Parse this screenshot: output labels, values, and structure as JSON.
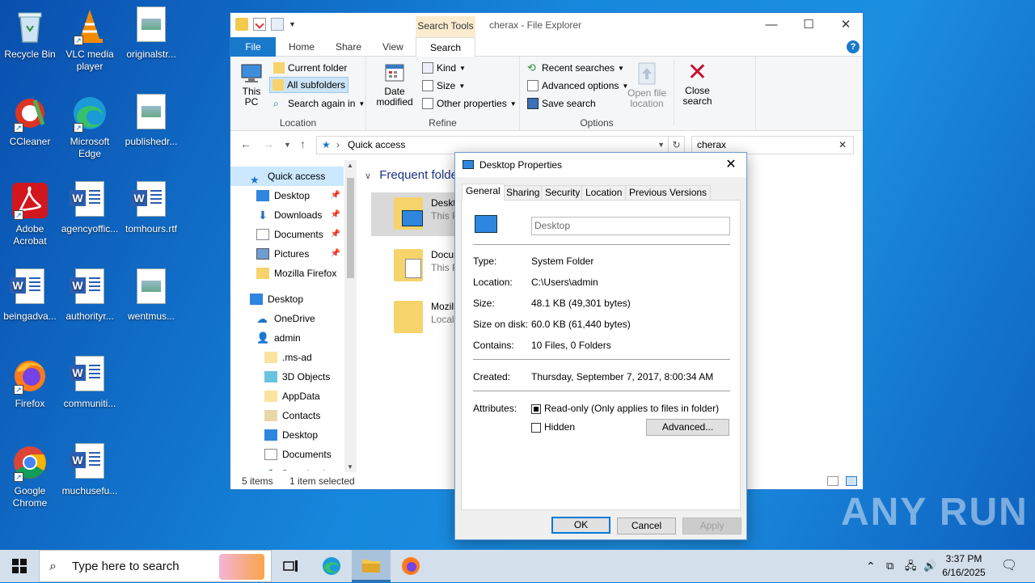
{
  "desktop": {
    "icons": [
      {
        "label": "Recycle Bin"
      },
      {
        "label": "VLC media player"
      },
      {
        "label": "originalstr..."
      },
      {
        "label": "CCleaner"
      },
      {
        "label": "Microsoft Edge"
      },
      {
        "label": "publishedr..."
      },
      {
        "label": "Adobe Acrobat"
      },
      {
        "label": "agencyoffic..."
      },
      {
        "label": "tomhours.rtf"
      },
      {
        "label": "beingadva..."
      },
      {
        "label": "authorityr..."
      },
      {
        "label": "wentmus..."
      },
      {
        "label": "Firefox"
      },
      {
        "label": "communiti..."
      },
      {
        "label": "Google Chrome"
      },
      {
        "label": "muchusefu..."
      }
    ],
    "watermark": "ANY RUN"
  },
  "explorer": {
    "title": "cherax - File Explorer",
    "context_tab": "Search Tools",
    "tabs": [
      "File",
      "Home",
      "Share",
      "View",
      "Search"
    ],
    "ribbon": {
      "location": {
        "label": "Location",
        "this_pc": "This PC",
        "current_folder": "Current folder",
        "all_subfolders": "All subfolders",
        "search_again": "Search again in"
      },
      "refine": {
        "label": "Refine",
        "date_modified": "Date modified",
        "kind": "Kind",
        "size": "Size",
        "other_properties": "Other properties"
      },
      "options": {
        "label": "Options",
        "recent_searches": "Recent searches",
        "advanced_options": "Advanced options",
        "save_search": "Save search",
        "open_file_location": "Open file location",
        "close_search": "Close search"
      }
    },
    "address": "Quick access",
    "search_value": "cherax",
    "nav": [
      {
        "label": "Quick access"
      },
      {
        "label": "Desktop"
      },
      {
        "label": "Downloads"
      },
      {
        "label": "Documents"
      },
      {
        "label": "Pictures"
      },
      {
        "label": "Mozilla Firefox"
      },
      {
        "label": "Desktop"
      },
      {
        "label": "OneDrive"
      },
      {
        "label": "admin"
      },
      {
        "label": ".ms-ad"
      },
      {
        "label": "3D Objects"
      },
      {
        "label": "AppData"
      },
      {
        "label": "Contacts"
      },
      {
        "label": "Desktop"
      },
      {
        "label": "Documents"
      },
      {
        "label": "Downloads"
      }
    ],
    "section_title": "Frequent folde",
    "tiles": [
      {
        "name": "Deskto",
        "sub": "This P"
      },
      {
        "name": "Docur",
        "sub": "This P"
      },
      {
        "name": "Mozill",
        "sub": "Local"
      }
    ],
    "status": {
      "items": "5 items",
      "selected": "1 item selected"
    }
  },
  "dialog": {
    "title": "Desktop Properties",
    "tabs": [
      "General",
      "Sharing",
      "Security",
      "Location",
      "Previous Versions"
    ],
    "name_value": "Desktop",
    "type_label": "Type:",
    "type_value": "System Folder",
    "location_label": "Location:",
    "location_value": "C:\\Users\\admin",
    "size_label": "Size:",
    "size_value": "48.1 KB (49,301 bytes)",
    "disk_label": "Size on disk:",
    "disk_value": "60.0 KB (61,440 bytes)",
    "contains_label": "Contains:",
    "contains_value": "10 Files, 0 Folders",
    "created_label": "Created:",
    "created_value": "Thursday, September 7, 2017, 8:00:34 AM",
    "attributes_label": "Attributes:",
    "readonly_label": "Read-only (Only applies to files in folder)",
    "hidden_label": "Hidden",
    "advanced_button": "Advanced...",
    "ok": "OK",
    "cancel": "Cancel",
    "apply": "Apply"
  },
  "taskbar": {
    "search_placeholder": "Type here to search",
    "time": "3:37 PM",
    "date": "6/16/2025"
  }
}
